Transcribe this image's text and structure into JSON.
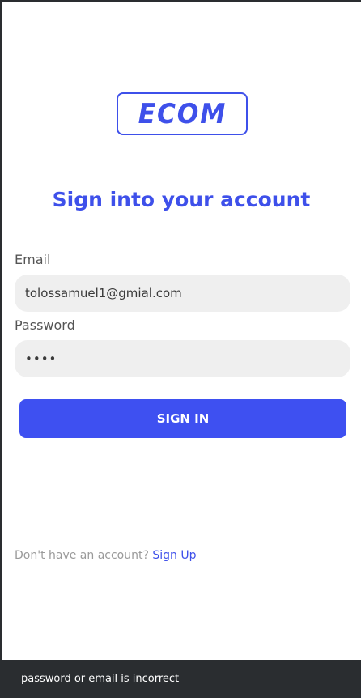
{
  "logo": {
    "text": "ECOM"
  },
  "title": "Sign into your account",
  "form": {
    "email_label": "Email",
    "email_value": "tolossamuel1@gmial.com",
    "password_label": "Password",
    "password_value": "••••",
    "submit_label": "SIGN IN"
  },
  "signup": {
    "prompt": "Don't have an account?",
    "link_label": "Sign Up"
  },
  "snackbar": {
    "message": "password or email is incorrect"
  },
  "colors": {
    "accent": "#3e50ea",
    "button": "#3e50f1",
    "field_bg": "#efefef",
    "snackbar_bg": "#2a2d30"
  }
}
